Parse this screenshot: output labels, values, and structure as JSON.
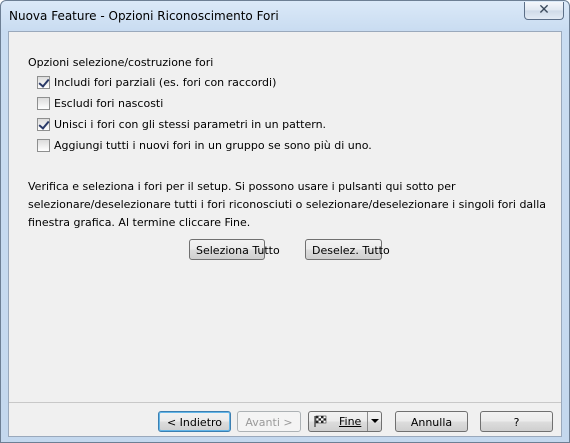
{
  "window": {
    "title": "Nuova Feature - Opzioni Riconoscimento Fori",
    "close_icon": "close-icon"
  },
  "options": {
    "section_label": "Opzioni selezione/costruzione fori",
    "items": [
      {
        "label": "Includi fori parziali (es. fori con raccordi)",
        "checked": true
      },
      {
        "label": "Escludi fori nascosti",
        "checked": false
      },
      {
        "label": "Unisci i fori con gli stessi parametri in un pattern.",
        "checked": true
      },
      {
        "label": "Aggiungi tutti i nuovi fori in un gruppo se sono più di uno.",
        "checked": false
      }
    ]
  },
  "description": "Verifica e seleziona i fori per il setup. Si possono usare i pulsanti qui sotto per selezionare/deselezionare tutti i fori riconosciuti o selezionare/deselezionare i singoli fori dalla finestra grafica. Al termine cliccare Fine.",
  "selection": {
    "select_all_label": "Seleziona Tutto",
    "deselect_all_label": "Deselez. Tutto"
  },
  "footer": {
    "back_label": "< Indietro",
    "next_label": "Avanti >",
    "finish_label": "Fine",
    "finish_icon": "checkered-flag-icon",
    "dropdown_icon": "chevron-down-icon",
    "cancel_label": "Annulla",
    "help_label": "?"
  }
}
